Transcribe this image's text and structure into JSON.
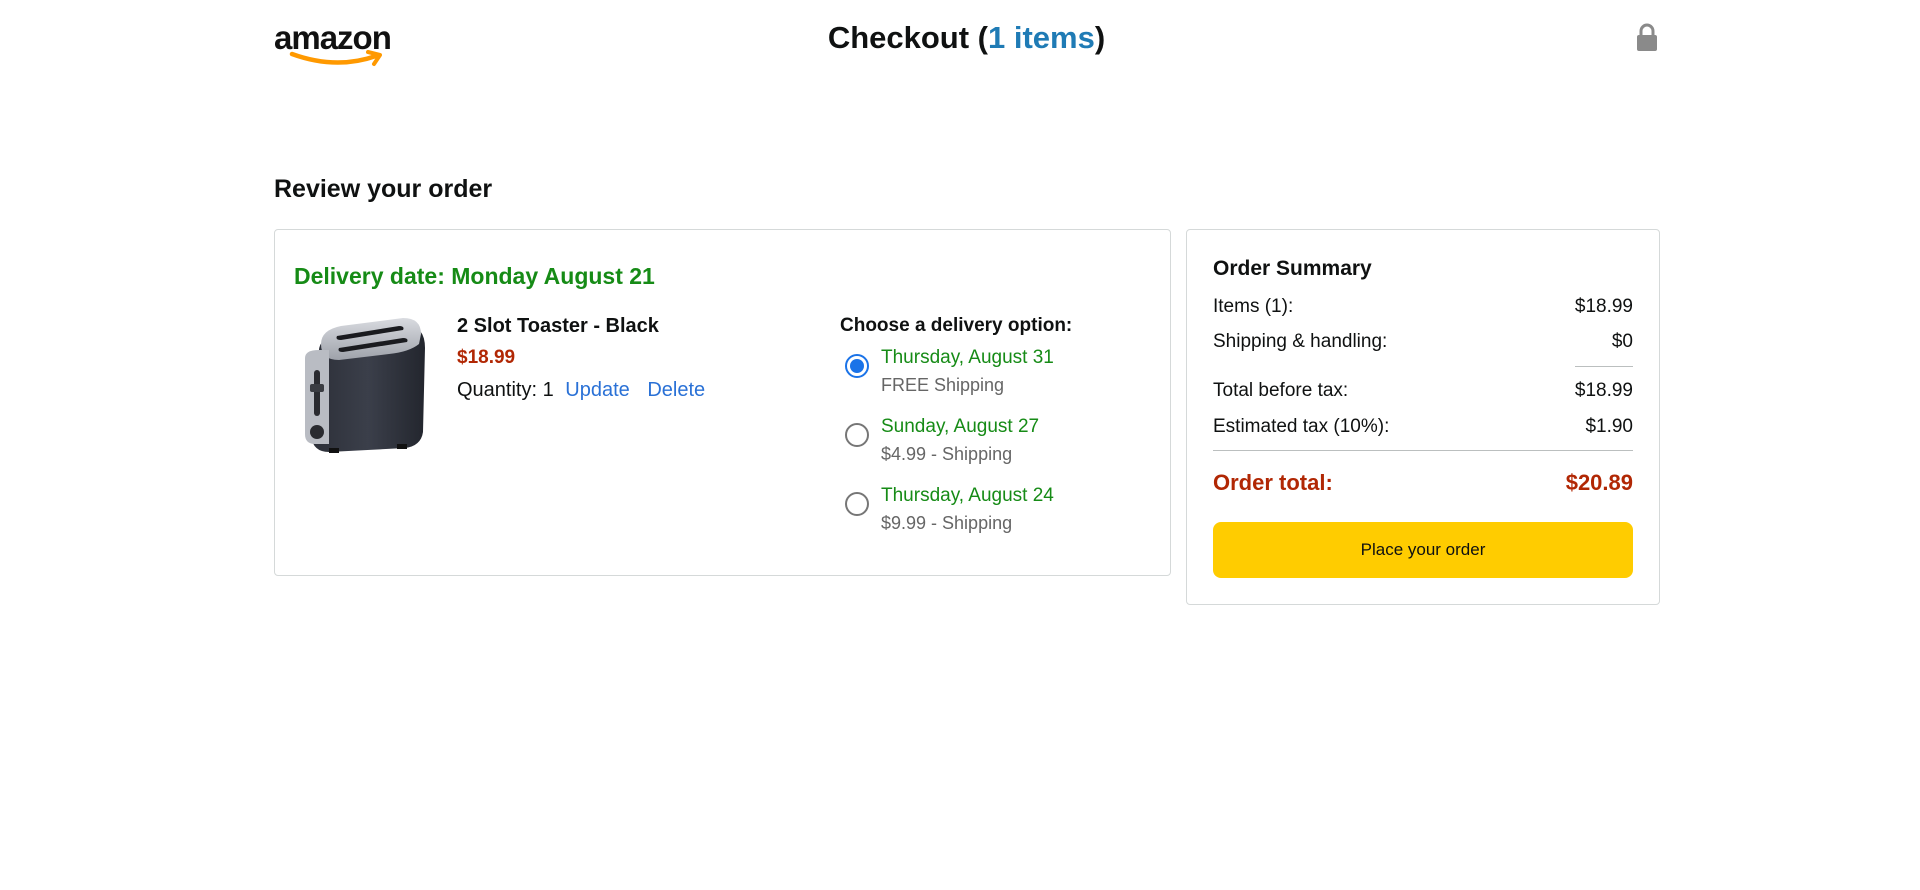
{
  "header": {
    "logo_text": "amazon",
    "title_prefix": "Checkout (",
    "title_count": "1 items",
    "title_suffix": ")"
  },
  "icons": {
    "logo": "amazon-smile-logo",
    "lock": "lock-icon"
  },
  "review": {
    "heading": "Review your order"
  },
  "order": {
    "delivery_date": "Delivery date: Monday August 21",
    "product": {
      "name": "2 Slot Toaster - Black",
      "price": "$18.99",
      "quantity_label": "Quantity: 1",
      "update_label": "Update",
      "delete_label": "Delete",
      "image": "black-toaster-image"
    },
    "delivery_options_heading": "Choose a delivery option:",
    "delivery_options": [
      {
        "date": "Thursday, August 31",
        "price": "FREE Shipping",
        "selected": true
      },
      {
        "date": "Sunday, August 27",
        "price": "$4.99 - Shipping",
        "selected": false
      },
      {
        "date": "Thursday, August 24",
        "price": "$9.99 - Shipping",
        "selected": false
      }
    ]
  },
  "summary": {
    "title": "Order Summary",
    "items_label": "Items (1):",
    "items_value": "$18.99",
    "shipping_label": "Shipping & handling:",
    "shipping_value": "$0",
    "before_tax_label": "Total before tax:",
    "before_tax_value": "$18.99",
    "tax_label": "Estimated tax (10%):",
    "tax_value": "$1.90",
    "total_label": "Order total:",
    "total_value": "$20.89",
    "place_order_label": "Place your order"
  },
  "colors": {
    "green": "#168b16",
    "price_red": "#b12704",
    "link_blue": "#2a71d6",
    "button_yellow": "#ffcc00",
    "title_blue": "#1f7bb5"
  }
}
